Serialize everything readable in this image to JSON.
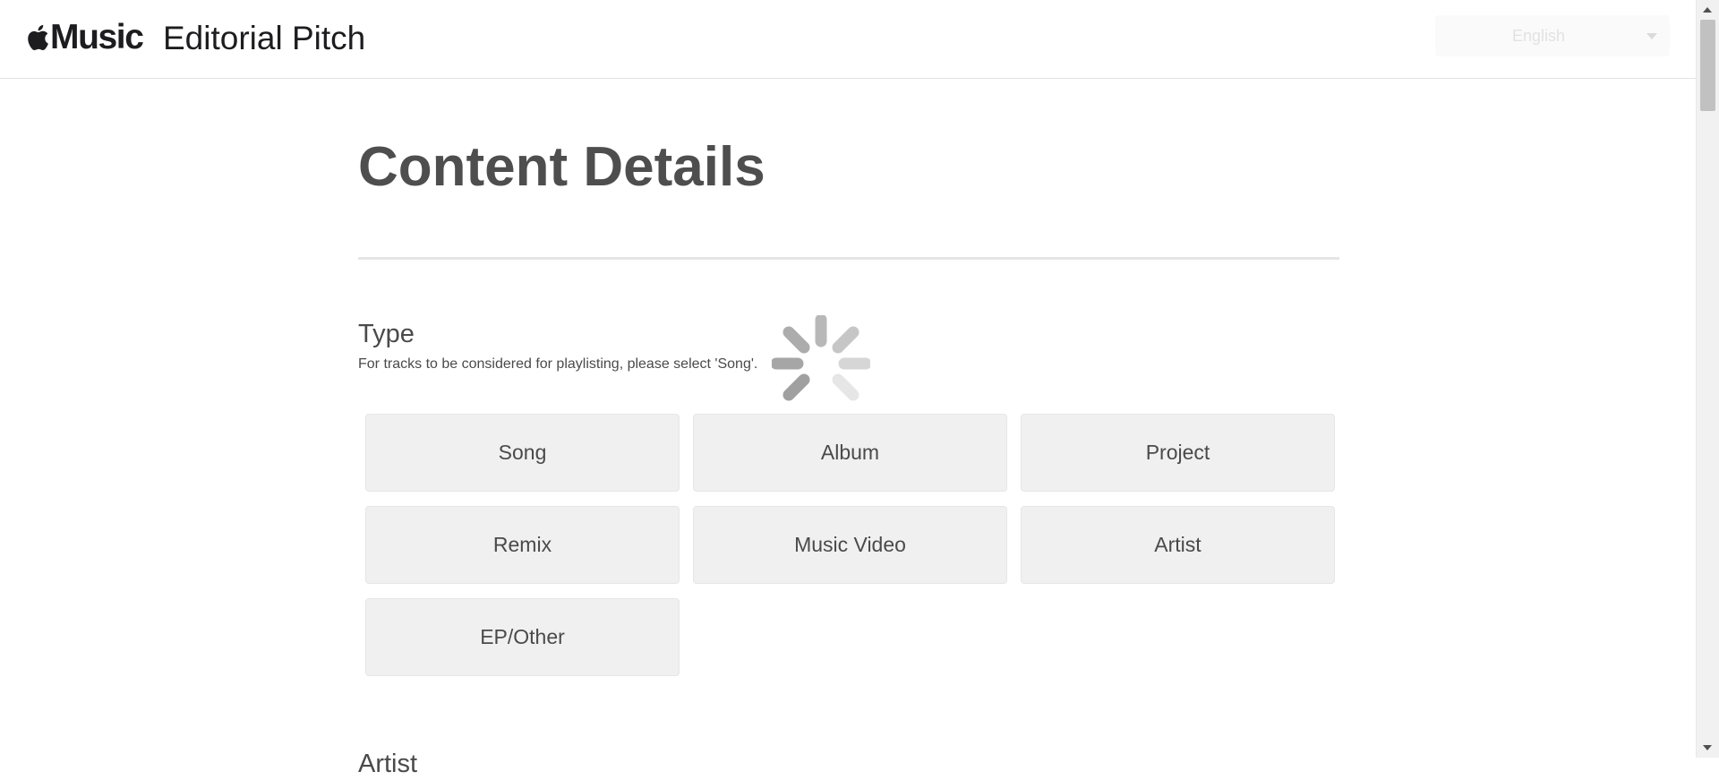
{
  "header": {
    "logo_text": "Music",
    "title": "Editorial Pitch",
    "language": {
      "selected": "English"
    }
  },
  "main": {
    "title": "Content Details",
    "type_section": {
      "title": "Type",
      "help_text": "For tracks to be considered for playlisting, please select 'Song'.",
      "options": [
        "Song",
        "Album",
        "Project",
        "Remix",
        "Music Video",
        "Artist",
        "EP/Other"
      ]
    },
    "next_section_title": "Artist"
  },
  "icons": {
    "logo": "apple-icon",
    "language_caret": "chevron-down-icon",
    "loading": "loading-spinner-icon"
  }
}
